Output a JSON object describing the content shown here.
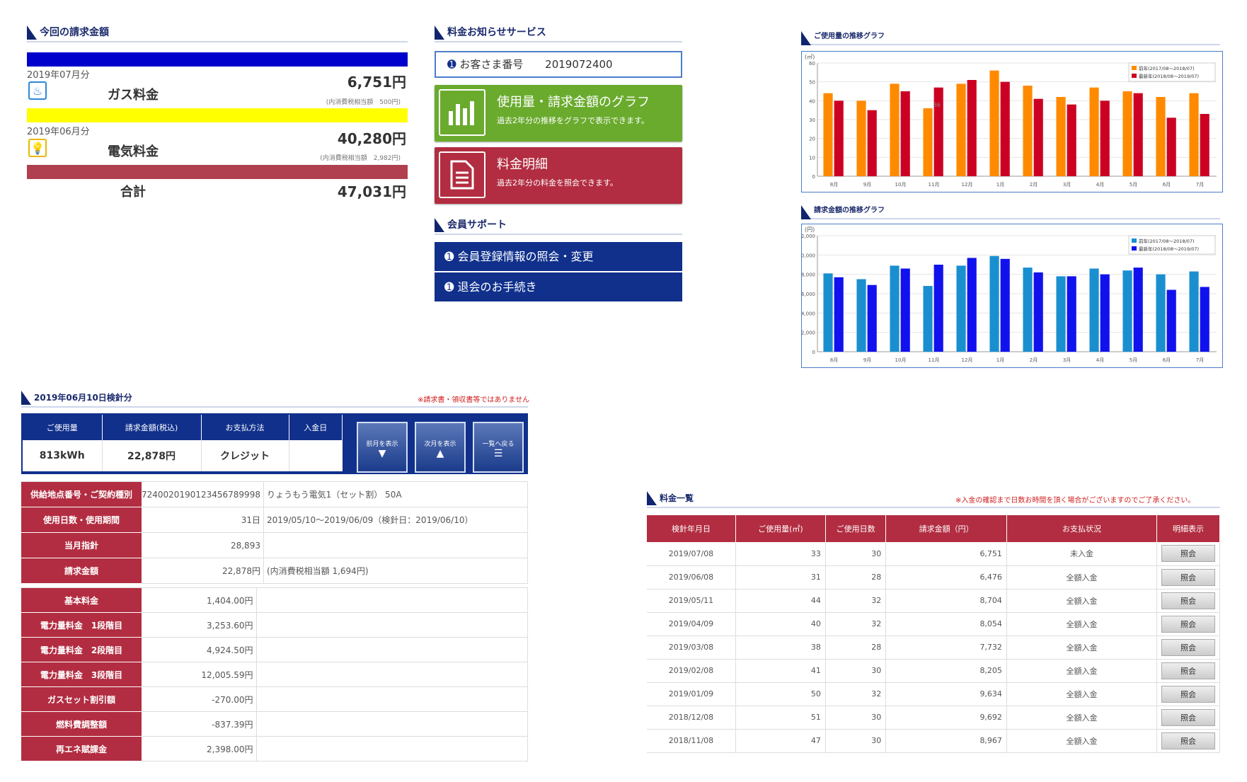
{
  "bill": {
    "title": "今回の請求金額",
    "gas": {
      "month": "2019年07月分",
      "label": "ガス料金",
      "amount": "6,751円",
      "tax": "(内消費税相当額　500円)"
    },
    "elec": {
      "month": "2019年06月分",
      "label": "電気料金",
      "amount": "40,280円",
      "tax": "(内消費税相当額　2,982円)"
    },
    "total": {
      "label": "合計",
      "amount": "47,031円"
    }
  },
  "notice": {
    "title": "料金お知らせサービス",
    "customer_label": "お客さま番号",
    "customer_no": "2019072400",
    "graph": {
      "title": "使用量・請求金額のグラフ",
      "desc": "過去2年分の推移をグラフで表示できます。"
    },
    "detail": {
      "title": "料金明細",
      "desc": "過去2年分の料金を照会できます。"
    }
  },
  "support": {
    "title": "会員サポート",
    "items": [
      "会員登録情報の照会・変更",
      "退会のお手続き"
    ]
  },
  "colors": {
    "navy": "#10308c",
    "green": "#6aab2e",
    "red": "#b22d41",
    "blue_bar": "#0000cc",
    "yellow_bar": "#ffff00"
  },
  "chart_data": [
    {
      "type": "bar",
      "title": "ご使用量の推移グラフ",
      "ylabel": "(㎥)",
      "ylim": [
        0,
        60
      ],
      "categories": [
        "8月",
        "9月",
        "10月",
        "11月",
        "12月",
        "1月",
        "2月",
        "3月",
        "4月",
        "5月",
        "6月",
        "7月"
      ],
      "series": [
        {
          "name": "前年(2017/08～2018/07)",
          "color": "#ff8a00",
          "values": [
            44,
            40,
            49,
            36,
            49,
            56,
            48,
            42,
            47,
            45,
            42,
            44
          ]
        },
        {
          "name": "最新年(2018/08～2019/07)",
          "color": "#cc0022",
          "values": [
            40,
            35,
            45,
            47,
            51,
            50,
            41,
            38,
            40,
            44,
            31,
            33
          ]
        }
      ],
      "annotation": "36"
    },
    {
      "type": "bar",
      "title": "請求金額の推移グラフ",
      "ylabel": "(円)",
      "ylim": [
        0,
        12000
      ],
      "categories": [
        "8月",
        "9月",
        "10月",
        "11月",
        "12月",
        "1月",
        "2月",
        "3月",
        "4月",
        "5月",
        "6月",
        "7月"
      ],
      "series": [
        {
          "name": "前年(2017/08～2018/07)",
          "color": "#1a8fd0",
          "values": [
            8100,
            7500,
            8900,
            6800,
            8900,
            9900,
            8700,
            7800,
            8600,
            8400,
            8000,
            8300
          ]
        },
        {
          "name": "最新年(2018/08～2019/07)",
          "color": "#1111ee",
          "values": [
            7700,
            6900,
            8600,
            9000,
            9700,
            9600,
            8200,
            7800,
            8000,
            8700,
            6400,
            6700
          ]
        }
      ]
    }
  ],
  "meter": {
    "title": "2019年06月10日検針分",
    "note": "※請求書・領収書等ではありません",
    "head": [
      "ご使用量",
      "請求金額(税込)",
      "お支払方法",
      "入金日"
    ],
    "vals": [
      "813kWh",
      "22,878円",
      "クレジット",
      ""
    ],
    "nav": [
      {
        "label": "前月を表示",
        "sym": "▼"
      },
      {
        "label": "次月を表示",
        "sym": "▲"
      },
      {
        "label": "一覧へ戻る",
        "sym": "☰"
      }
    ],
    "rows1": [
      {
        "k": "供給地点番号・ご契約種別",
        "v": "7240020190123456789998",
        "v2": "りょうもう電気1（セット割） 50A"
      },
      {
        "k": "使用日数・使用期間",
        "v": "31日",
        "v2": "2019/05/10～2019/06/09（検針日：2019/06/10）"
      },
      {
        "k": "当月指針",
        "v": "28,893",
        "v2": ""
      },
      {
        "k": "請求金額",
        "v": "22,878円",
        "v2": "(内消費税相当額 1,694円)"
      }
    ],
    "rows2": [
      {
        "k": "基本料金",
        "v": "1,404.00円"
      },
      {
        "k": "電力量料金　1段階目",
        "v": "3,253.60円"
      },
      {
        "k": "電力量料金　2段階目",
        "v": "4,924.50円"
      },
      {
        "k": "電力量料金　3段階目",
        "v": "12,005.59円"
      },
      {
        "k": "ガスセット割引額",
        "v": "-270.00円"
      },
      {
        "k": "燃料費調整額",
        "v": "-837.39円"
      },
      {
        "k": "再エネ賦課金",
        "v": "2,398.00円"
      }
    ]
  },
  "list": {
    "title": "料金一覧",
    "note": "※入金の確認まで日数お時間を頂く場合がございますのでご了承ください。",
    "head": [
      "検針年月日",
      "ご使用量(㎥)",
      "ご使用日数",
      "請求金額（円）",
      "お支払状況",
      "明細表示"
    ],
    "btn": "照会",
    "rows": [
      [
        "2019/07/08",
        "33",
        "30",
        "6,751",
        "未入金"
      ],
      [
        "2019/06/08",
        "31",
        "28",
        "6,476",
        "全額入金"
      ],
      [
        "2019/05/11",
        "44",
        "32",
        "8,704",
        "全額入金"
      ],
      [
        "2019/04/09",
        "40",
        "32",
        "8,054",
        "全額入金"
      ],
      [
        "2019/03/08",
        "38",
        "28",
        "7,732",
        "全額入金"
      ],
      [
        "2019/02/08",
        "41",
        "30",
        "8,205",
        "全額入金"
      ],
      [
        "2019/01/09",
        "50",
        "32",
        "9,634",
        "全額入金"
      ],
      [
        "2018/12/08",
        "51",
        "30",
        "9,692",
        "全額入金"
      ],
      [
        "2018/11/08",
        "47",
        "30",
        "8,967",
        "全額入金"
      ]
    ]
  }
}
